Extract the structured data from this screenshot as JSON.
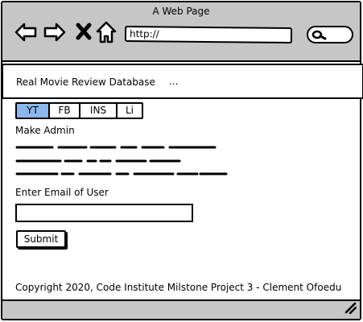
{
  "browser": {
    "title": "A Web Page",
    "url": "http://",
    "icons": [
      "back-arrow-icon",
      "forward-arrow-icon",
      "close-x-icon",
      "home-icon",
      "search-icon",
      "resize-grip-icon"
    ]
  },
  "header": {
    "brand": "Real Movie Review Database",
    "ellipsis": "..."
  },
  "tabs": [
    {
      "label": "YT",
      "active": true
    },
    {
      "label": "FB",
      "active": false
    },
    {
      "label": "INS",
      "active": false
    },
    {
      "label": "Li",
      "active": false
    }
  ],
  "section": {
    "title": "Make Admin"
  },
  "form": {
    "email_label": "Enter Email of User",
    "email_value": "",
    "submit_label": "Submit"
  },
  "footer": {
    "copyright": "Copyright 2020, Code Institute Milstone Project 3 - Clement Ofoedu"
  },
  "colors": {
    "chrome": "#c6c6c6",
    "active_tab": "#8cb6ec"
  }
}
